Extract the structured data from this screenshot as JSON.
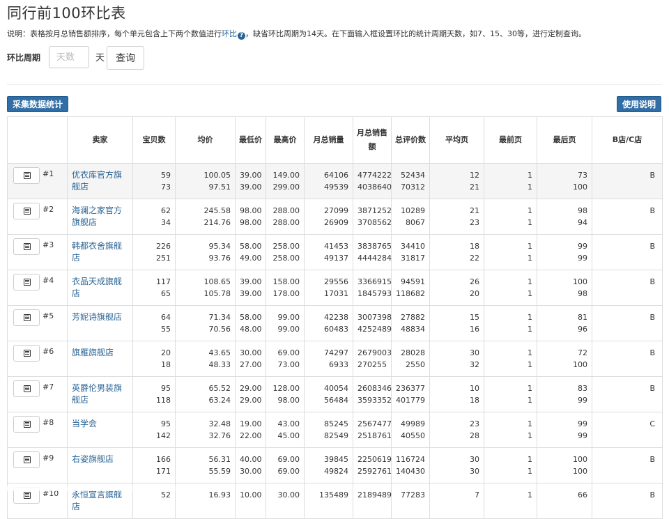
{
  "page": {
    "title": "同行前100环比表",
    "description_prefix": "说明：表格按月总销售额排序，每个单元包含上下两个数值进行",
    "description_link": "环比",
    "help_icon": "question-circle-icon",
    "description_suffix": "，缺省环比周期为14天。在下面输入框设置环比的统计周期天数，如7、15、30等，进行定制查询。"
  },
  "filter": {
    "label": "环比周期",
    "placeholder": "天数",
    "value": "",
    "unit": "天",
    "query_button": "查询"
  },
  "toolbar": {
    "collect_button": "采集数据统计",
    "manual_button": "使用说明"
  },
  "colors": {
    "accent": "#2f6ea7",
    "link": "#2a6496",
    "border": "#dddddd",
    "highlight_row": "#f5f5f5"
  },
  "table": {
    "headers": {
      "seller": "卖家",
      "items": "宝贝数",
      "avg_price": "均价",
      "min_price": "最低价",
      "max_price": "最高价",
      "monthly_volume": "月总销量",
      "monthly_revenue": "月总销售额",
      "reviews": "总评价数",
      "avg_page": "平均页",
      "first_page": "最前页",
      "last_page": "最后页",
      "shop_type": "B店/C店"
    },
    "rows": [
      {
        "rank": "#1",
        "seller": "优衣库官方旗舰店",
        "items": [
          "59",
          "73"
        ],
        "avg_price": [
          "100.05",
          "97.51"
        ],
        "min_price": [
          "39.00",
          "39.00"
        ],
        "max_price": [
          "149.00",
          "299.00"
        ],
        "monthly_volume": [
          "64106",
          "49539"
        ],
        "monthly_revenue": [
          "4774222",
          "4038640"
        ],
        "reviews": [
          "52434",
          "70312"
        ],
        "avg_page": [
          "12",
          "21"
        ],
        "first_page": [
          "1",
          "1"
        ],
        "last_page": [
          "73",
          "100"
        ],
        "shop_type": "B"
      },
      {
        "rank": "#2",
        "seller": "海澜之家官方旗舰店",
        "items": [
          "62",
          "34"
        ],
        "avg_price": [
          "245.58",
          "214.76"
        ],
        "min_price": [
          "98.00",
          "98.00"
        ],
        "max_price": [
          "288.00",
          "288.00"
        ],
        "monthly_volume": [
          "27099",
          "26909"
        ],
        "monthly_revenue": [
          "3871252",
          "3708562"
        ],
        "reviews": [
          "10289",
          "8067"
        ],
        "avg_page": [
          "21",
          "23"
        ],
        "first_page": [
          "1",
          "1"
        ],
        "last_page": [
          "98",
          "94"
        ],
        "shop_type": "B"
      },
      {
        "rank": "#3",
        "seller": "韩都衣舍旗舰店",
        "items": [
          "226",
          "251"
        ],
        "avg_price": [
          "95.34",
          "93.76"
        ],
        "min_price": [
          "58.00",
          "49.00"
        ],
        "max_price": [
          "258.00",
          "258.00"
        ],
        "monthly_volume": [
          "41453",
          "49137"
        ],
        "monthly_revenue": [
          "3838765",
          "4444284"
        ],
        "reviews": [
          "34410",
          "31817"
        ],
        "avg_page": [
          "18",
          "22"
        ],
        "first_page": [
          "1",
          "1"
        ],
        "last_page": [
          "99",
          "99"
        ],
        "shop_type": "B"
      },
      {
        "rank": "#4",
        "seller": "衣品天成旗舰店",
        "items": [
          "117",
          "65"
        ],
        "avg_price": [
          "108.65",
          "105.78"
        ],
        "min_price": [
          "39.00",
          "39.00"
        ],
        "max_price": [
          "158.00",
          "178.00"
        ],
        "monthly_volume": [
          "29556",
          "17031"
        ],
        "monthly_revenue": [
          "3366915",
          "1845793"
        ],
        "reviews": [
          "94591",
          "118682"
        ],
        "avg_page": [
          "26",
          "20"
        ],
        "first_page": [
          "1",
          "1"
        ],
        "last_page": [
          "100",
          "98"
        ],
        "shop_type": "B"
      },
      {
        "rank": "#5",
        "seller": "芳妮诗旗舰店",
        "items": [
          "64",
          "55"
        ],
        "avg_price": [
          "71.34",
          "70.56"
        ],
        "min_price": [
          "58.00",
          "48.00"
        ],
        "max_price": [
          "99.00",
          "99.00"
        ],
        "monthly_volume": [
          "42238",
          "60483"
        ],
        "monthly_revenue": [
          "3007398",
          "4252489"
        ],
        "reviews": [
          "27882",
          "48834"
        ],
        "avg_page": [
          "15",
          "16"
        ],
        "first_page": [
          "1",
          "1"
        ],
        "last_page": [
          "81",
          "96"
        ],
        "shop_type": "B"
      },
      {
        "rank": "#6",
        "seller": "旗雁旗舰店",
        "items": [
          "20",
          "18"
        ],
        "avg_price": [
          "43.65",
          "48.33"
        ],
        "min_price": [
          "30.00",
          "27.00"
        ],
        "max_price": [
          "69.00",
          "73.00"
        ],
        "monthly_volume": [
          "74297",
          "6933"
        ],
        "monthly_revenue": [
          "2679003",
          "270255"
        ],
        "reviews": [
          "28028",
          "2550"
        ],
        "avg_page": [
          "30",
          "32"
        ],
        "first_page": [
          "1",
          "1"
        ],
        "last_page": [
          "72",
          "100"
        ],
        "shop_type": "B"
      },
      {
        "rank": "#7",
        "seller": "英爵伦男装旗舰店",
        "items": [
          "95",
          "118"
        ],
        "avg_price": [
          "65.52",
          "63.24"
        ],
        "min_price": [
          "29.00",
          "29.00"
        ],
        "max_price": [
          "128.00",
          "98.00"
        ],
        "monthly_volume": [
          "40054",
          "56484"
        ],
        "monthly_revenue": [
          "2608346",
          "3593352"
        ],
        "reviews": [
          "236377",
          "401779"
        ],
        "avg_page": [
          "10",
          "18"
        ],
        "first_page": [
          "1",
          "1"
        ],
        "last_page": [
          "83",
          "99"
        ],
        "shop_type": "B"
      },
      {
        "rank": "#8",
        "seller": "当学会",
        "items": [
          "95",
          "142"
        ],
        "avg_price": [
          "32.48",
          "32.76"
        ],
        "min_price": [
          "19.00",
          "22.00"
        ],
        "max_price": [
          "43.00",
          "45.00"
        ],
        "monthly_volume": [
          "85245",
          "82549"
        ],
        "monthly_revenue": [
          "2567477",
          "2518761"
        ],
        "reviews": [
          "49989",
          "40550"
        ],
        "avg_page": [
          "23",
          "28"
        ],
        "first_page": [
          "1",
          "1"
        ],
        "last_page": [
          "99",
          "99"
        ],
        "shop_type": "C"
      },
      {
        "rank": "#9",
        "seller": "右姿旗舰店",
        "items": [
          "166",
          "171"
        ],
        "avg_price": [
          "56.31",
          "55.59"
        ],
        "min_price": [
          "40.00",
          "30.00"
        ],
        "max_price": [
          "69.00",
          "69.00"
        ],
        "monthly_volume": [
          "39845",
          "49824"
        ],
        "monthly_revenue": [
          "2250619",
          "2592761"
        ],
        "reviews": [
          "116724",
          "140430"
        ],
        "avg_page": [
          "30",
          "30"
        ],
        "first_page": [
          "1",
          "1"
        ],
        "last_page": [
          "100",
          "100"
        ],
        "shop_type": "B"
      },
      {
        "rank": "#10",
        "seller": "永恒宣言旗舰店",
        "items": [
          "52",
          ""
        ],
        "avg_price": [
          "16.93",
          ""
        ],
        "min_price": [
          "10.00",
          ""
        ],
        "max_price": [
          "30.00",
          ""
        ],
        "monthly_volume": [
          "135489",
          ""
        ],
        "monthly_revenue": [
          "2189489",
          ""
        ],
        "reviews": [
          "77283",
          ""
        ],
        "avg_page": [
          "7",
          ""
        ],
        "first_page": [
          "1",
          ""
        ],
        "last_page": [
          "66",
          ""
        ],
        "shop_type": "B"
      }
    ]
  }
}
